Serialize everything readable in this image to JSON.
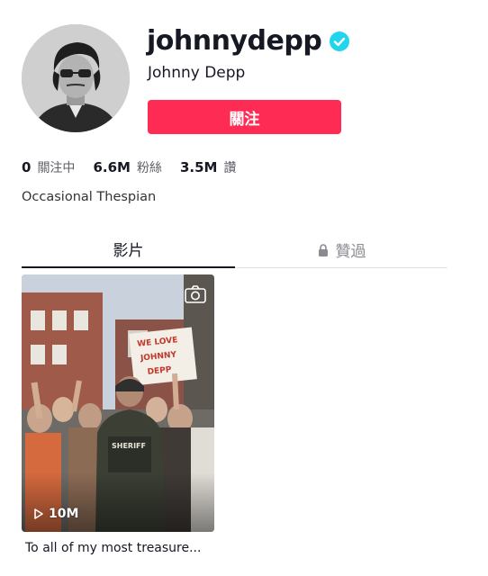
{
  "profile": {
    "username": "johnnydepp",
    "display_name": "Johnny Depp",
    "verified": true,
    "follow_label": "關注",
    "bio": "Occasional Thespian",
    "stats": [
      {
        "value": "0",
        "label": "關注中"
      },
      {
        "value": "6.6M",
        "label": "粉絲"
      },
      {
        "value": "3.5M",
        "label": "讚"
      }
    ]
  },
  "tabs": {
    "videos_label": "影片",
    "liked_label": "贊過"
  },
  "videos": [
    {
      "views": "10M",
      "caption": "To all of my most treasure...",
      "sign_text": [
        "WE LOVE",
        "JOHNNY",
        "DEPP"
      ],
      "vest_text": "SHERIFF"
    }
  ],
  "colors": {
    "accent": "#fe2c55",
    "verified": "#20d5ec",
    "text": "#161823"
  },
  "icons": {
    "verified": "verified-badge-icon",
    "lock": "lock-icon",
    "play": "play-icon",
    "camera": "camera-icon"
  }
}
